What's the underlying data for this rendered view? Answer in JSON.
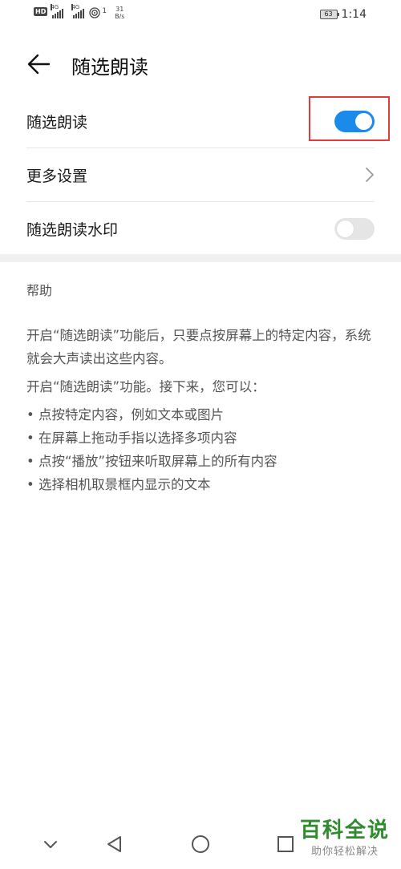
{
  "status_bar": {
    "hd_label": "HD",
    "net1": "4G",
    "net2": "4G",
    "wifi_count": "1",
    "speed_value": "31",
    "speed_unit": "B/s",
    "battery": "63",
    "time": "1:14"
  },
  "header": {
    "title": "随选朗读",
    "back_icon": "arrow-left-icon"
  },
  "settings": [
    {
      "label": "随选朗读",
      "control": "toggle",
      "state": "on"
    },
    {
      "label": "更多设置",
      "control": "chevron"
    },
    {
      "label": "随选朗读水印",
      "control": "toggle",
      "state": "off"
    }
  ],
  "help": {
    "title": "帮助",
    "paragraph1": "开启“随选朗读”功能后，只要点按屏幕上的特定内容，系统就会大声读出这些内容。",
    "paragraph2": "开启“随选朗读”功能。接下来，您可以：",
    "bullets": [
      "点按特定内容，例如文本或图片",
      "在屏幕上拖动手指以选择多项内容",
      "点按“播放”按钮来听取屏幕上的所有内容",
      "选择相机取景框内显示的文本"
    ]
  },
  "watermark": {
    "brand": "百科全说",
    "slogan": "助你轻松解决"
  },
  "colors": {
    "toggle_on": "#1a8bea",
    "toggle_off": "#e5e5e5",
    "highlight": "#e33b3b",
    "watermark_green": "#2e8b2e"
  }
}
